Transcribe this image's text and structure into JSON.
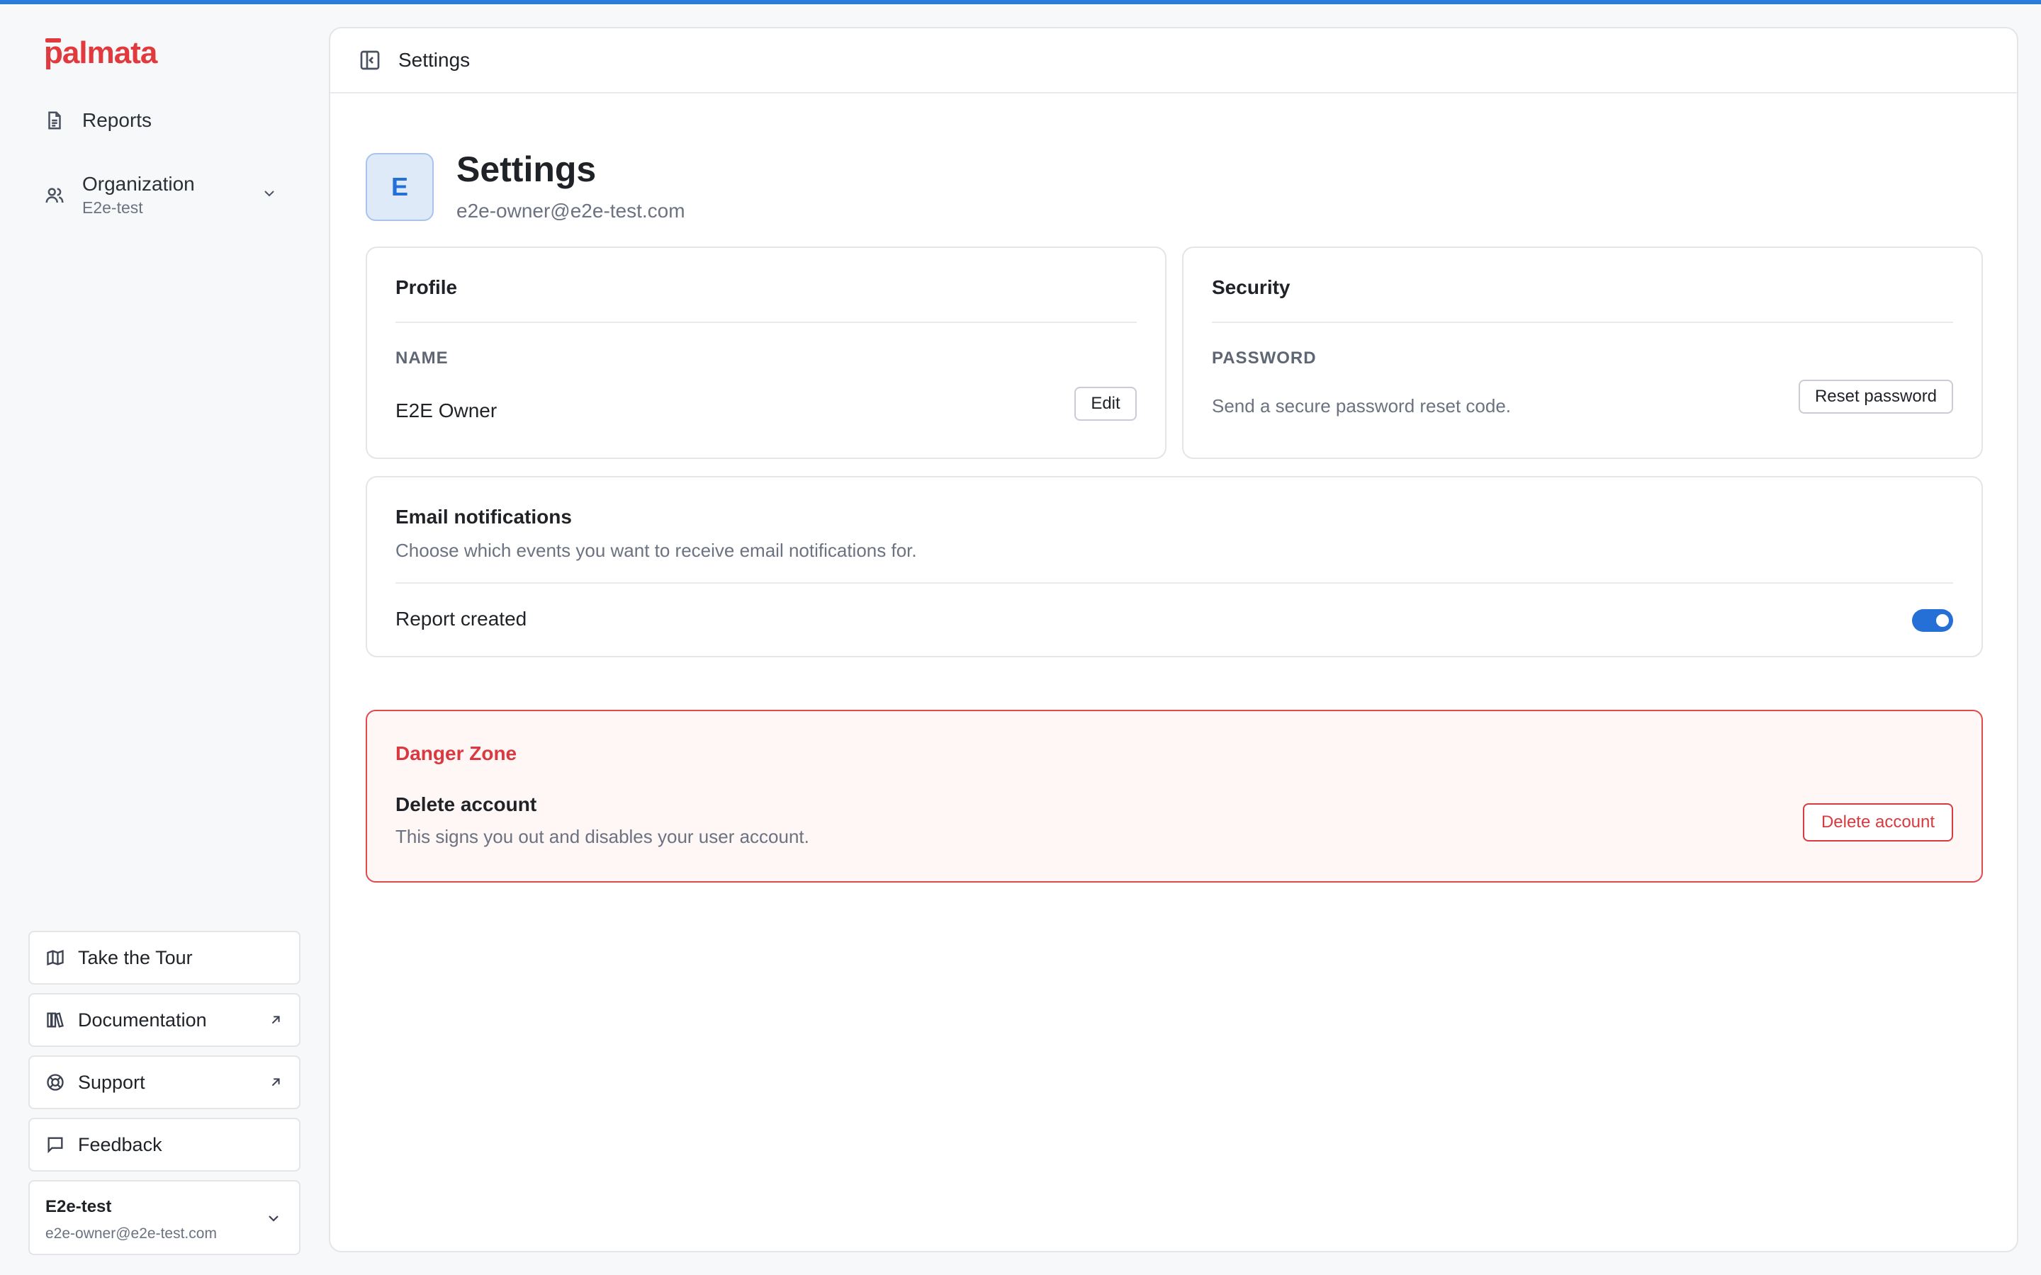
{
  "brand": {
    "name": "palmata",
    "color": "#e0393e",
    "accent": "#2470d6",
    "danger": "#d83a40"
  },
  "sidebar": {
    "nav": [
      {
        "label": "Reports",
        "icon": "document-icon"
      },
      {
        "label": "Organization",
        "sub": "E2e-test",
        "icon": "users-icon"
      }
    ],
    "footer_links": [
      {
        "label": "Take the Tour",
        "icon": "map-icon"
      },
      {
        "label": "Documentation",
        "icon": "books-icon",
        "external": true
      },
      {
        "label": "Support",
        "icon": "lifebuoy-icon",
        "external": true
      },
      {
        "label": "Feedback",
        "icon": "message-icon"
      }
    ],
    "account": {
      "org": "E2e-test",
      "email": "e2e-owner@e2e-test.com"
    }
  },
  "header": {
    "title": "Settings"
  },
  "page": {
    "avatar_letter": "E",
    "title": "Settings",
    "email": "e2e-owner@e2e-test.com"
  },
  "profile": {
    "heading": "Profile",
    "label": "NAME",
    "value": "E2E Owner",
    "edit_label": "Edit"
  },
  "security": {
    "heading": "Security",
    "label": "PASSWORD",
    "description": "Send a secure password reset code.",
    "button_label": "Reset password"
  },
  "notifications": {
    "heading": "Email notifications",
    "description": "Choose which events you want to receive email notifications for.",
    "row_label": "Report created",
    "enabled": true
  },
  "danger": {
    "heading": "Danger Zone",
    "title": "Delete account",
    "description": "This signs you out and disables your user account.",
    "button_label": "Delete account"
  }
}
